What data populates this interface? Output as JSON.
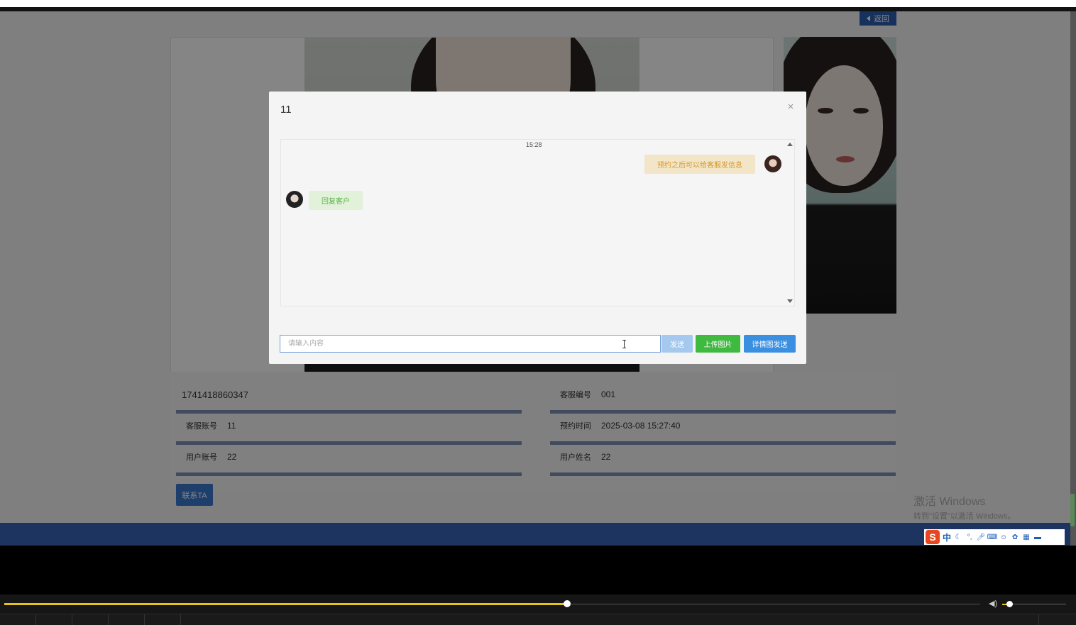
{
  "header": {
    "back_label": "返回"
  },
  "details": {
    "order_no": "1741418860347",
    "service_no_label": "客服编号",
    "service_no": "001",
    "service_account_label": "客服账号",
    "service_account": "11",
    "appointment_time_label": "预约时间",
    "appointment_time": "2025-03-08 15:27:40",
    "user_account_label": "用户账号",
    "user_account": "22",
    "user_name_label": "用户姓名",
    "user_name": "22",
    "contact_label": "联系TA"
  },
  "modal": {
    "title": "11",
    "close_glyph": "×",
    "chat": {
      "time": "15:28",
      "messages": [
        {
          "side": "right",
          "text": "预约之后可以给客服发信息"
        },
        {
          "side": "left",
          "text": "回复客户"
        }
      ]
    },
    "input_placeholder": "请输入内容",
    "send_label": "发送",
    "upload_label": "上传图片",
    "detail_send_label": "详情图发送"
  },
  "watermark": {
    "line1": "激活 Windows",
    "line2": "转到\"设置\"以激活 Windows。"
  },
  "ime": {
    "logo": "S",
    "mode": "中"
  },
  "player": {
    "progress_fraction": 0.58,
    "volume_fraction": 0.12
  },
  "colors": {
    "accent_blue": "#3b8fe0",
    "send_green": "#3fb93f",
    "taskbar": "#1d3461",
    "seek": "#e6c21a"
  }
}
